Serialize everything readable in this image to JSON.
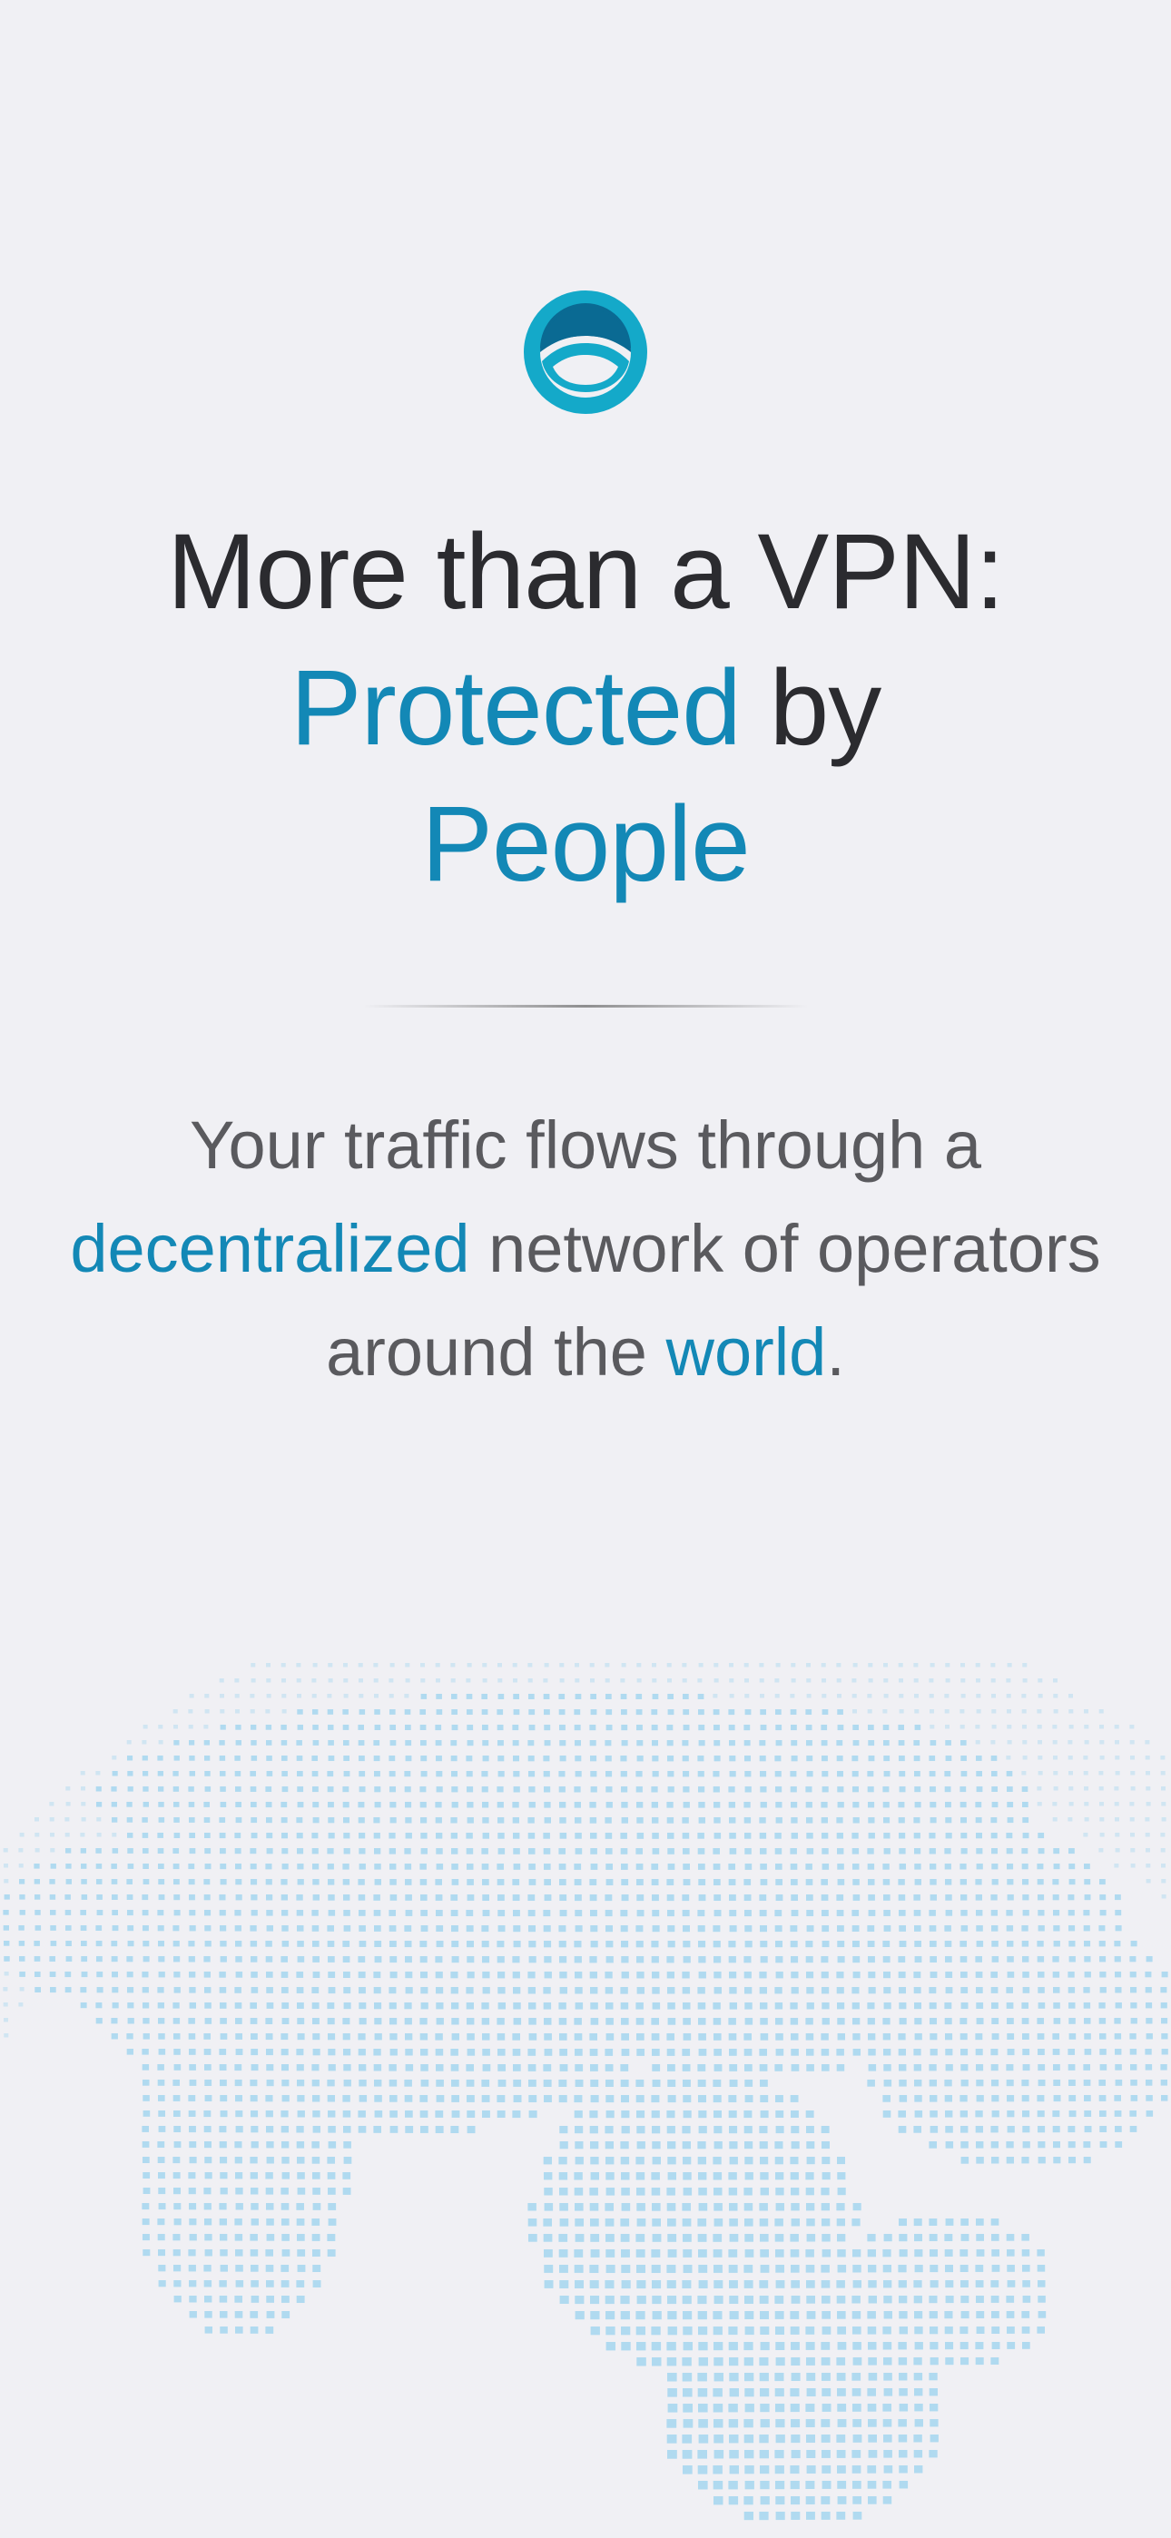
{
  "logo": {
    "icon": "app-logo-icon",
    "ring_color": "#14a9c9",
    "dome_color": "#0a6a93"
  },
  "headline": {
    "line1": "More than a VPN:",
    "line2_accent": "Protected",
    "line2_rest": " by",
    "line3_accent": "People"
  },
  "description": {
    "part1": "Your traffic flows through a",
    "accent1": "decentralized",
    "part2": " network of operators around the ",
    "accent2": "world",
    "part3": "."
  },
  "illustration": {
    "icon": "dotted-globe-icon",
    "dot_color": "#a9d7f0"
  },
  "colors": {
    "accent": "#1388b6",
    "headline": "#2b2b2f",
    "body": "#5a5a5e",
    "background": "#f0f0f4"
  }
}
